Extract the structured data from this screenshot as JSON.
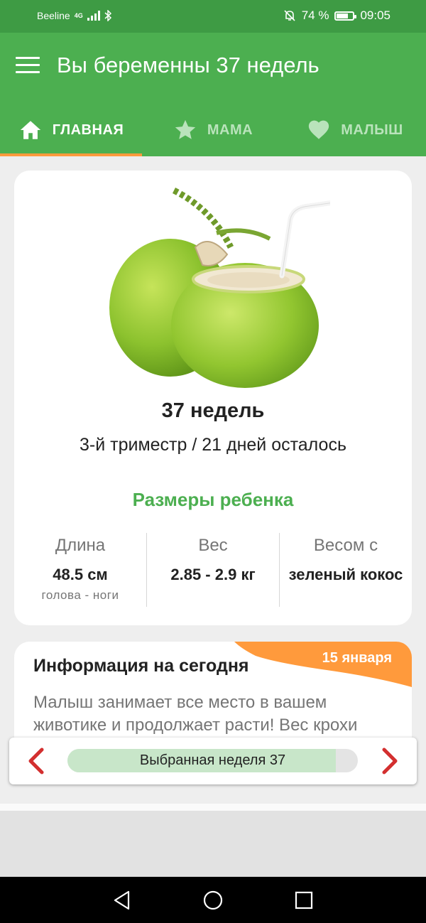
{
  "status_bar": {
    "carrier": "Beeline",
    "network": "4G",
    "battery_percent": "74 %",
    "battery_level": 0.74,
    "time": "09:05"
  },
  "app_bar": {
    "title": "Вы беременны 37 недель",
    "menu_icon": "hamburger-menu-icon"
  },
  "tabs": [
    {
      "label": "ГЛАВНАЯ",
      "icon": "home-icon",
      "active": true
    },
    {
      "label": "МАМА",
      "icon": "star-icon",
      "active": false
    },
    {
      "label": "МАЛЫШ",
      "icon": "heart-icon",
      "active": false
    }
  ],
  "colors": {
    "primary": "#4caf50",
    "status_bar": "#3e9b44",
    "accent": "#ff9a3c",
    "arrow": "#d32f2f",
    "progress_fill": "#c8e6c9"
  },
  "week_card": {
    "image": "green-coconut",
    "title": "37 недель",
    "subtitle": "3-й триместр / 21 дней осталось",
    "sizes_title": "Размеры ребенка",
    "stats": [
      {
        "label": "Длина",
        "value": "48.5 см",
        "note": "голова - ноги"
      },
      {
        "label": "Вес",
        "value": "2.85 - 2.9 кг",
        "note": ""
      },
      {
        "label": "Весом с",
        "value": "зеленый кокос",
        "note": ""
      }
    ]
  },
  "info_card": {
    "date": "15 января",
    "title": "Информация на сегодня",
    "text": "Малыш занимает все место в вашем животике и продолжает расти! Вес крохи"
  },
  "week_selector": {
    "label": "Выбранная неделя 37",
    "progress_fraction": 0.925,
    "prev_icon": "chevron-left-icon",
    "next_icon": "chevron-right-icon"
  },
  "nav_bar": {
    "back_icon": "back-icon",
    "home_icon": "home-circle-icon",
    "recents_icon": "recents-icon"
  }
}
